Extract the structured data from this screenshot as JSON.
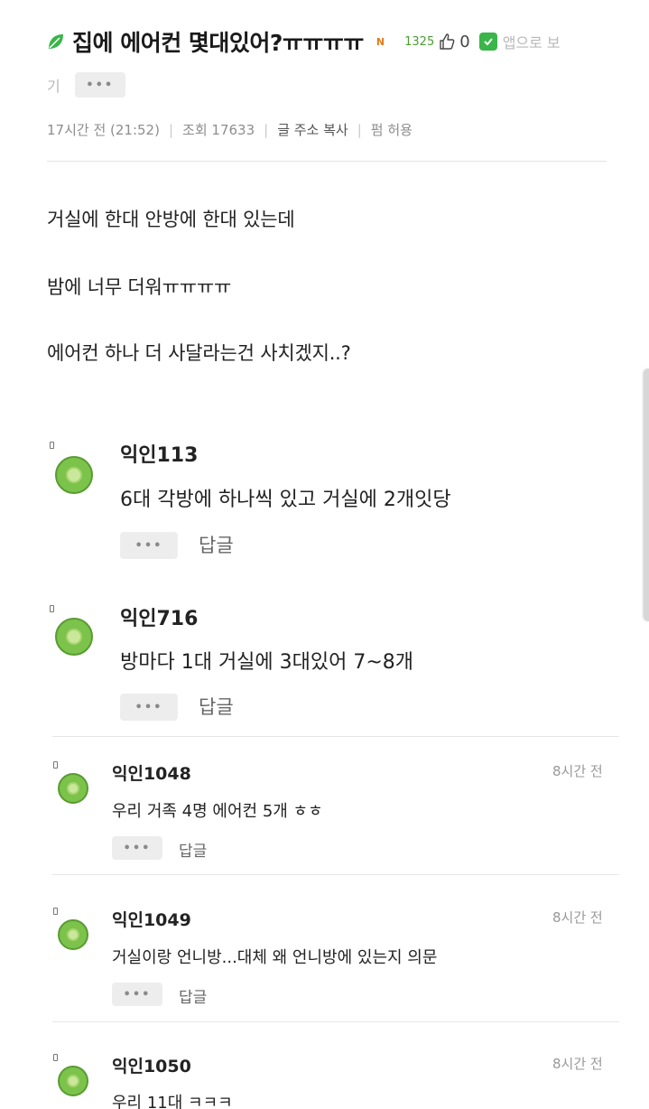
{
  "post": {
    "title": "집에 에어컨 몇대있어?ㅠㅠㅠㅠ",
    "new_badge": "N",
    "like_count": "1325",
    "dislike_count": "0",
    "app_button_label_part1": "앱으로 보",
    "app_button_label_part2": "기",
    "more_label": "•••",
    "time": "17시간 전 (21:52)",
    "views": "조회 17633",
    "copy_address": "글 주소 복사",
    "share": "펌 허용",
    "body": [
      "거실에 한대 안방에 한대 있는데",
      "밤에 너무 더워ㅠㅠㅠㅠ",
      "에어컨 하나 더 사달라는건 사치겠지..?"
    ]
  },
  "comments": [
    {
      "nick": "익인113",
      "text": "6대 각방에 하나씩 있고 거실에 2개잇당",
      "reply": "답글",
      "more": "•••",
      "time": ""
    },
    {
      "nick": "익인716",
      "text": "방마다 1대 거실에 3대있어 7~8개",
      "reply": "답글",
      "more": "•••",
      "time": ""
    },
    {
      "nick": "익인1048",
      "text": "우리 거족 4명 에어컨 5개 ㅎㅎ",
      "reply": "답글",
      "more": "•••",
      "time": "8시간 전"
    },
    {
      "nick": "익인1049",
      "text": "거실이랑 언니방...대체 왜 언니방에 있는지 의문",
      "reply": "답글",
      "more": "•••",
      "time": "8시간 전"
    },
    {
      "nick": "익인1050",
      "text": "우리 11대 ㅋㅋㅋ",
      "reply": "답글",
      "more": "•••",
      "time": "8시간 전"
    }
  ],
  "colors": {
    "accent_green": "#3ab54a",
    "avatar_green": "#7bc34a",
    "like_green": "#4a9d2f",
    "new_badge_orange": "#e07b1a"
  },
  "icons": [
    "leaf-icon",
    "thumbs-up-icon",
    "app-check-icon",
    "avatar-icon"
  ]
}
